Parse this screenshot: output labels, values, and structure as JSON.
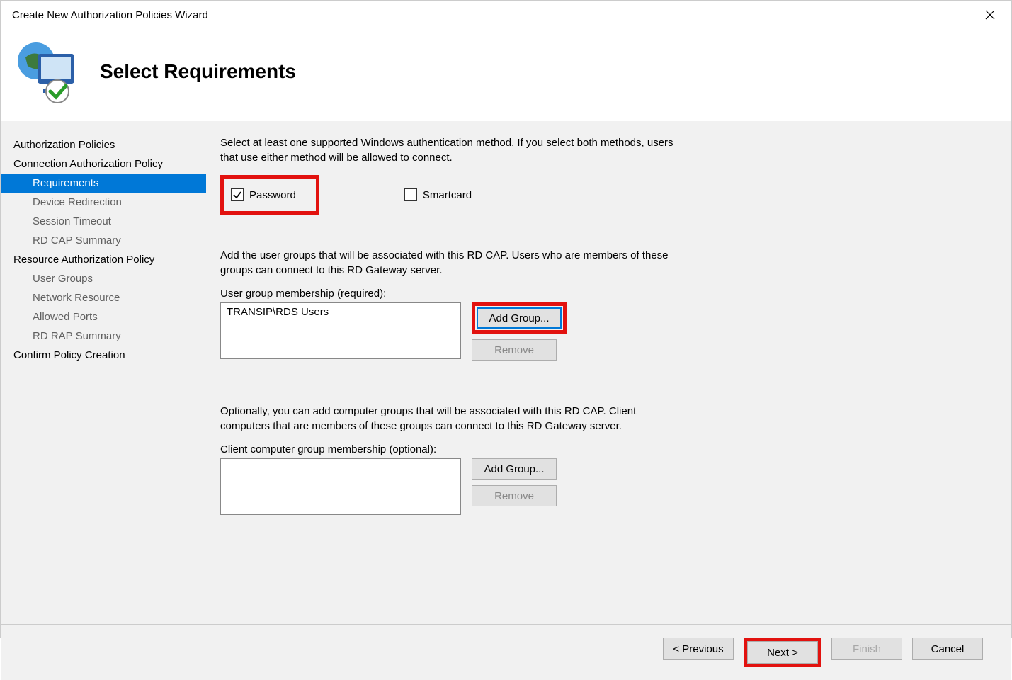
{
  "window": {
    "title": "Create New Authorization Policies Wizard"
  },
  "header": {
    "title": "Select Requirements"
  },
  "sidebar": {
    "items": [
      {
        "label": "Authorization Policies",
        "level": 0,
        "selected": false
      },
      {
        "label": "Connection Authorization Policy",
        "level": 0,
        "selected": false
      },
      {
        "label": "Requirements",
        "level": 1,
        "selected": true
      },
      {
        "label": "Device Redirection",
        "level": 1,
        "selected": false
      },
      {
        "label": "Session Timeout",
        "level": 1,
        "selected": false
      },
      {
        "label": "RD CAP Summary",
        "level": 1,
        "selected": false
      },
      {
        "label": "Resource Authorization Policy",
        "level": 0,
        "selected": false
      },
      {
        "label": "User Groups",
        "level": 1,
        "selected": false
      },
      {
        "label": "Network Resource",
        "level": 1,
        "selected": false
      },
      {
        "label": "Allowed Ports",
        "level": 1,
        "selected": false
      },
      {
        "label": "RD RAP Summary",
        "level": 1,
        "selected": false
      },
      {
        "label": "Confirm Policy Creation",
        "level": 0,
        "selected": false
      }
    ]
  },
  "content": {
    "auth_desc": "Select at least one supported Windows authentication method. If you select both methods, users that use either method will be allowed to connect.",
    "password_label": "Password",
    "password_checked": true,
    "smartcard_label": "Smartcard",
    "smartcard_checked": false,
    "user_groups_desc": "Add the user groups that will be associated with this RD CAP. Users who are members of these groups can connect to this RD Gateway server.",
    "user_group_label": "User group membership (required):",
    "user_group_items": [
      "TRANSIP\\RDS Users"
    ],
    "add_group_label": "Add Group...",
    "remove_label": "Remove",
    "computer_groups_desc": "Optionally, you can add computer groups that will be associated with this RD CAP. Client computers that are members of these groups can connect to this RD Gateway server.",
    "computer_group_label": "Client computer group membership (optional):",
    "computer_group_items": []
  },
  "footer": {
    "previous": "< Previous",
    "next": "Next >",
    "finish": "Finish",
    "cancel": "Cancel"
  }
}
